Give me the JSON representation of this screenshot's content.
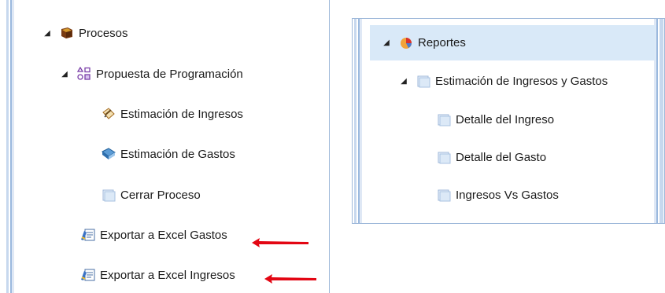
{
  "left_tree": {
    "root": {
      "label": "Procesos",
      "icon": "book-icon",
      "expanded": true
    },
    "group": {
      "label": "Propuesta de Programación",
      "icon": "shapes-icon",
      "expanded": true
    },
    "children": [
      {
        "label": "Estimación de Ingresos",
        "icon": "pencil-document-icon"
      },
      {
        "label": "Estimación de Gastos",
        "icon": "blue-book-icon"
      },
      {
        "label": "Cerrar Proceso",
        "icon": "page-icon"
      }
    ],
    "exports": [
      {
        "label": "Exportar a Excel Gastos",
        "icon": "report-edit-icon"
      },
      {
        "label": "Exportar a Excel Ingresos",
        "icon": "report-edit-icon"
      }
    ]
  },
  "right_tree": {
    "root": {
      "label": "Reportes",
      "icon": "chart-icon",
      "expanded": true
    },
    "group": {
      "label": "Estimación de Ingresos y Gastos",
      "icon": "page-icon",
      "expanded": true
    },
    "children": [
      {
        "label": "Detalle del Ingreso",
        "icon": "page-icon"
      },
      {
        "label": "Detalle del Gasto",
        "icon": "page-icon"
      },
      {
        "label": "Ingresos Vs Gastos",
        "icon": "page-icon"
      }
    ]
  },
  "colors": {
    "arrow": "#e30613",
    "selection": "#d9e9f8",
    "border": "#9db7d9"
  }
}
